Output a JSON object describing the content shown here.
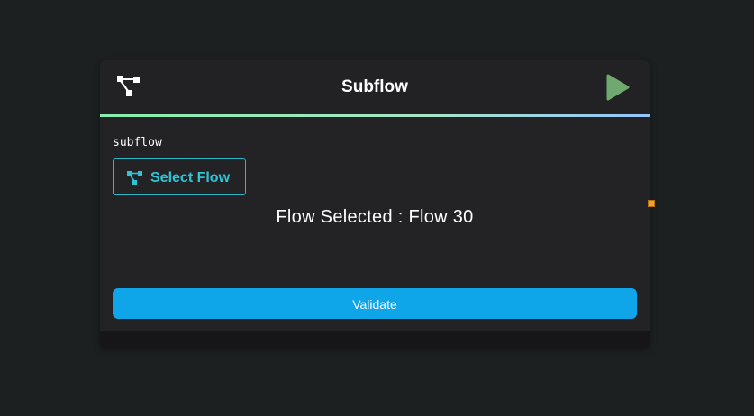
{
  "node": {
    "title": "Subflow",
    "header_icon": "flow-tree-icon",
    "run_icon": "play-icon",
    "run_color": "#6fa96f",
    "label": "subflow",
    "select_button": {
      "label": "Select Flow",
      "icon": "flow-tree-icon",
      "color": "#2ec4d6"
    },
    "flow_selected_text": "Flow Selected : Flow 30",
    "validate_label": "Validate",
    "validate_color": "#0ea5e9",
    "output_handle_color": "#f0a030",
    "accent_gradient": [
      "#86efac",
      "#93c5fd"
    ]
  }
}
